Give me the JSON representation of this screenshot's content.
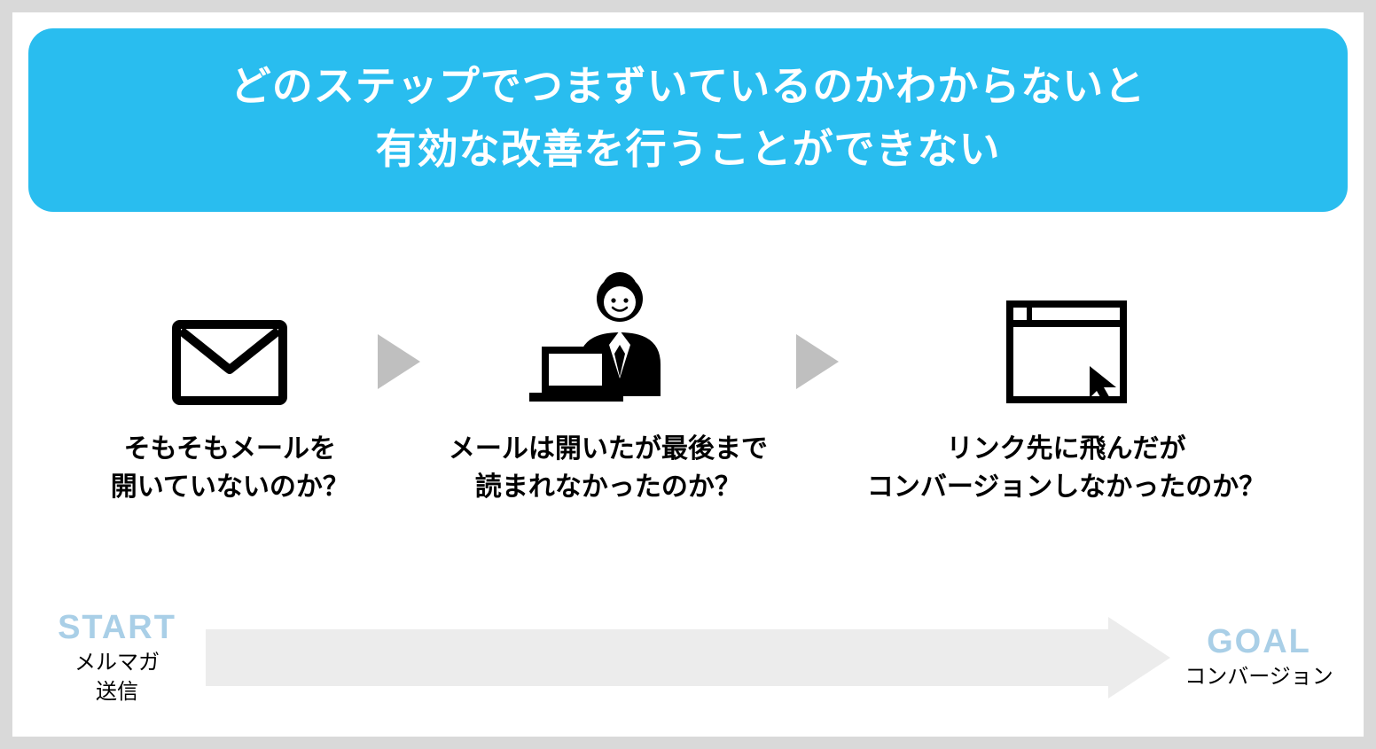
{
  "banner": {
    "line1": "どのステップでつまずいているのかわからないと",
    "line2": "有効な改善を行うことができない"
  },
  "steps": [
    {
      "icon": "envelope-icon",
      "label": "そもそもメールを\n開いていないのか？"
    },
    {
      "icon": "person-laptop-icon",
      "label": "メールは開いたが最後まで\n読まれなかったのか？"
    },
    {
      "icon": "browser-cursor-icon",
      "label": "リンク先に飛んだが\nコンバージョンしなかったのか？"
    }
  ],
  "timeline": {
    "start": {
      "tag": "START",
      "sub": "メルマガ\n送信"
    },
    "goal": {
      "tag": "GOAL",
      "sub": "コンバージョン"
    }
  }
}
